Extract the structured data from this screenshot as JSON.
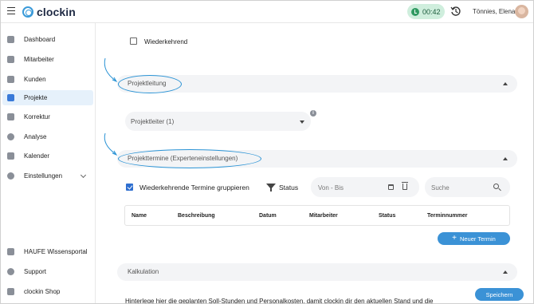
{
  "app": {
    "name": "clockin"
  },
  "header": {
    "timer": "00:42",
    "user_name": "Tönnies, Elena"
  },
  "sidebar": {
    "items": [
      {
        "label": "Dashboard",
        "icon": "dashboard-icon"
      },
      {
        "label": "Mitarbeiter",
        "icon": "people-icon"
      },
      {
        "label": "Kunden",
        "icon": "handshake-icon"
      },
      {
        "label": "Projekte",
        "icon": "projects-icon",
        "active": true
      },
      {
        "label": "Korrektur",
        "icon": "correction-icon"
      },
      {
        "label": "Analyse",
        "icon": "analysis-icon"
      },
      {
        "label": "Kalender",
        "icon": "calendar-icon"
      },
      {
        "label": "Einstellungen",
        "icon": "settings-icon"
      }
    ],
    "bottom_items": [
      {
        "label": "HAUFE Wissensportal",
        "icon": "book-icon"
      },
      {
        "label": "Support",
        "icon": "info-icon"
      },
      {
        "label": "clockin Shop",
        "icon": "cart-icon"
      }
    ]
  },
  "main": {
    "recurring_label": "Wiederkehrend",
    "section_project_lead": "Projektleitung",
    "project_lead_select": "Projektleiter (1)",
    "section_dates": "Projekttermine (Experteneinstellungen)",
    "group_recurring_label": "Wiederkehrende Termine gruppieren",
    "status_filter": "Status",
    "date_placeholder": "Von - Bis",
    "search_placeholder": "Suche",
    "table_headers": [
      "Name",
      "Beschreibung",
      "Datum",
      "Mitarbeiter",
      "Status",
      "Terminnummer"
    ],
    "new_appointment_button": "Neuer Termin",
    "section_calculation": "Kalkulation",
    "save_button": "Speichern",
    "calculation_text": "Hinterlege hier die geplanten Soll-Stunden und Personalkosten, damit clockin dir den aktuellen Stand und die"
  },
  "colors": {
    "accent": "#3b92d6",
    "timer_bg": "#cfeedd",
    "active_nav": "#e6f1fb",
    "highlight": "#2a93d5"
  }
}
